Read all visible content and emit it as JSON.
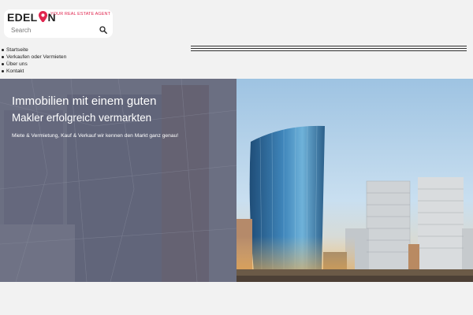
{
  "header": {
    "logo_left": "EDEL",
    "logo_right": "N",
    "tagline": "YOUR REAL ESTATE AGENT",
    "search_placeholder": "Search",
    "search_icon": "search-icon",
    "menu_icon": "hamburger-icon"
  },
  "nav": {
    "items": [
      "Startseite",
      "Verkaufen oder Vermieten",
      "Über uns",
      "Kontakt"
    ]
  },
  "hero": {
    "title": "Immobilien mit einem guten",
    "subtitle": "Makler erfolgreich vermarkten",
    "tagline": "Miete & Vermietung, Kauf & Verkauf wir kennen den Markt ganz genau!"
  },
  "colors": {
    "brand_red": "#e0264f",
    "overlay": "#5a5f75",
    "sky": "#aecde6"
  }
}
